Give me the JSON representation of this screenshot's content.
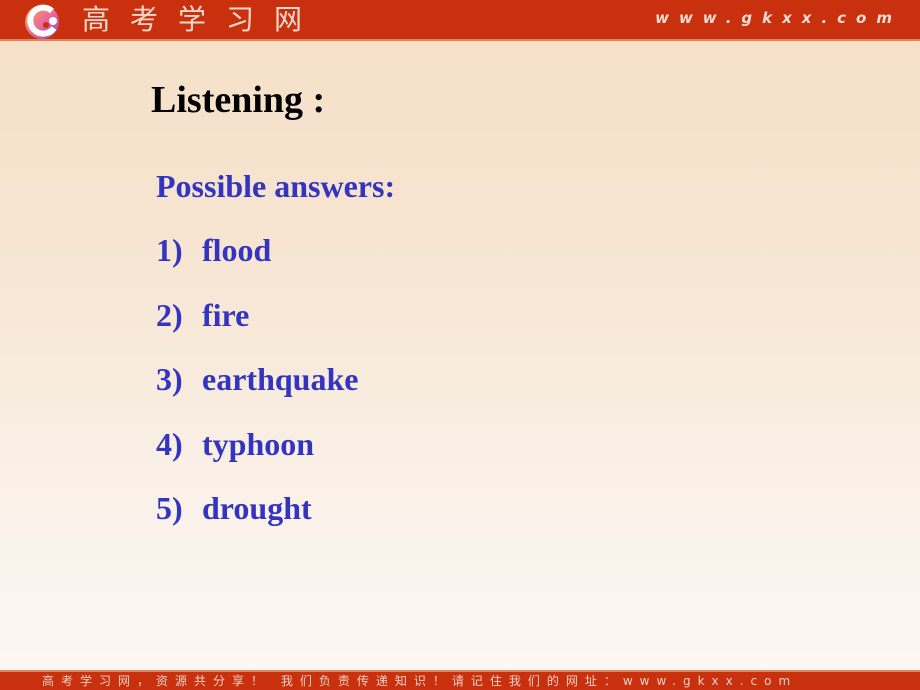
{
  "header": {
    "brand": "高考学习网",
    "url": "www.gkxx.com",
    "logo_icon": "gkxx-logo-icon"
  },
  "slide": {
    "title": "Listening :",
    "subtitle": "Possible answers:",
    "answers": [
      {
        "num": "1)",
        "text": "flood"
      },
      {
        "num": "2)",
        "text": "fire"
      },
      {
        "num": "3)",
        "text": "earthquake"
      },
      {
        "num": "4)",
        "text": "typhoon"
      },
      {
        "num": "5)",
        "text": "drought"
      }
    ]
  },
  "footer": {
    "text": "高考学习网，资源共分享！ 我们负责传递知识！请记住我们的网址：www.gkxx.com"
  },
  "colors": {
    "header_bg": "#c8300e",
    "answer_text": "#3334bf",
    "title_text": "#000000"
  }
}
